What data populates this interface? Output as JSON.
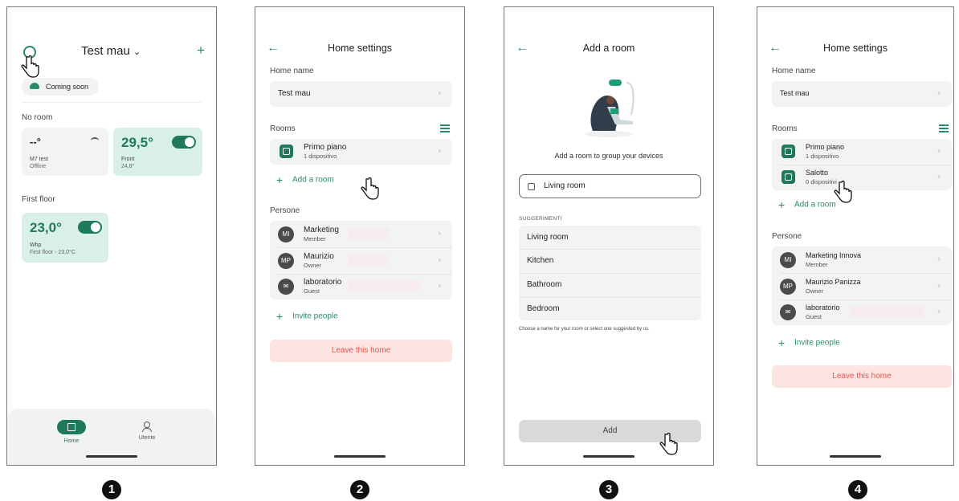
{
  "steps": [
    "1",
    "2",
    "3",
    "4"
  ],
  "screen1": {
    "home_title": "Test mau",
    "chevron": "chevron-down",
    "plus": "+",
    "coming_soon": "Coming soon",
    "no_room_label": "No room",
    "device1": {
      "value": "--°",
      "name": "M7 test",
      "status": "Offline"
    },
    "device2": {
      "value": "29,5°",
      "name": "Front",
      "sub": "24,8°"
    },
    "first_floor_label": "First floor",
    "device3": {
      "value": "23,0°",
      "name": "Whp",
      "sub": "First floor - 23,0°C"
    },
    "nav_home": "Home",
    "nav_user": "Utente"
  },
  "screen2": {
    "title": "Home settings",
    "home_name_label": "Home name",
    "home_name": "Test mau",
    "rooms_label": "Rooms",
    "room1": {
      "name": "Primo piano",
      "devices": "1 dispositivo"
    },
    "add_room": "Add a room",
    "people_label": "Persone",
    "people": [
      {
        "initials": "MI",
        "name": "Marketing",
        "role": "Member"
      },
      {
        "initials": "MP",
        "name": "Maurizio",
        "role": "Owner"
      },
      {
        "initials": "",
        "name": "laboratorio",
        "role": "Guest"
      }
    ],
    "invite": "Invite people",
    "leave": "Leave this home"
  },
  "screen3": {
    "title": "Add a room",
    "subtitle": "Add a room to group your devices",
    "input_value": "Living room",
    "suggestions_label": "SUGGERIMENTI",
    "suggestions": [
      "Living room",
      "Kitchen",
      "Bathroom",
      "Bedroom"
    ],
    "hint": "Choose a name for your room or select one suggested by us.",
    "add_button": "Add"
  },
  "screen4": {
    "title": "Home settings",
    "home_name_label": "Home name",
    "home_name": "Test mau",
    "rooms_label": "Rooms",
    "rooms": [
      {
        "name": "Primo piano",
        "devices": "1 dispositivo"
      },
      {
        "name": "Salotto",
        "devices": "0 dispositivi"
      }
    ],
    "add_room": "Add a room",
    "people_label": "Persone",
    "people": [
      {
        "initials": "MI",
        "name": "Marketing Innova",
        "role": "Member"
      },
      {
        "initials": "MP",
        "name": "Maurizio Panizza",
        "role": "Owner"
      },
      {
        "initials": "",
        "name": "laboratorio",
        "role": "Guest"
      }
    ],
    "invite": "Invite people",
    "leave": "Leave this home"
  },
  "colors": {
    "accent": "#2a8a6e",
    "tile": "#d9efe9",
    "leave_bg": "#fbe4e2",
    "leave_text": "#e2574c"
  }
}
